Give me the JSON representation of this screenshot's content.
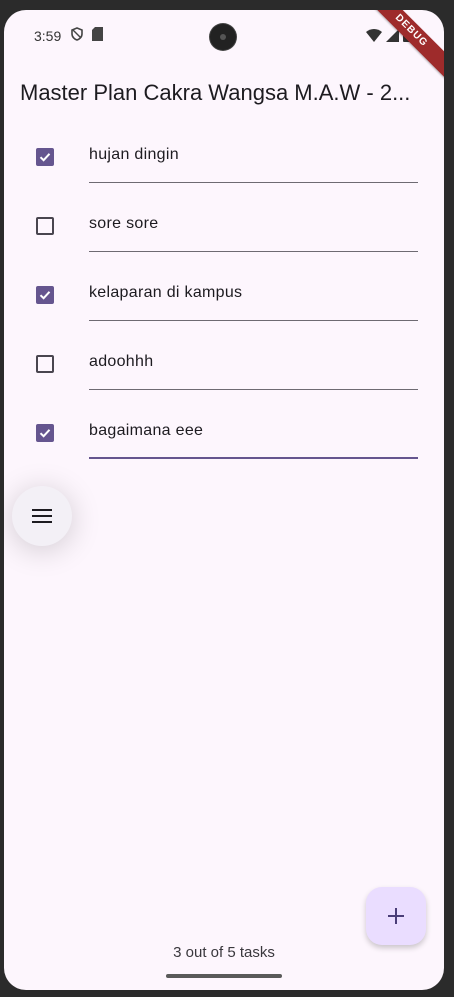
{
  "status_bar": {
    "time": "3:59",
    "debug_label": "DEBUG"
  },
  "app_bar": {
    "title": "Master Plan Cakra Wangsa M.A.W - 2..."
  },
  "tasks": [
    {
      "text": "hujan dingin",
      "checked": true
    },
    {
      "text": "sore sore",
      "checked": false
    },
    {
      "text": "kelaparan di kampus",
      "checked": true
    },
    {
      "text": "adoohhh",
      "checked": false
    },
    {
      "text": "bagaimana eee",
      "checked": true
    }
  ],
  "summary": "3 out of 5 tasks",
  "icons": {
    "menu": "menu-icon",
    "add": "add-icon"
  },
  "colors": {
    "accent": "#65558f",
    "background": "#fdf6fd",
    "fab": "#eaddff"
  }
}
